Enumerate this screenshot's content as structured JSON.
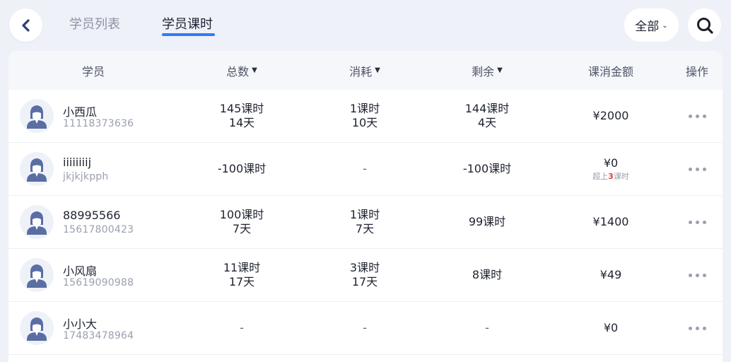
{
  "tabs": {
    "student_list": "学员列表",
    "student_hours": "学员课时"
  },
  "filter": {
    "label": "全部",
    "caret": "⌄"
  },
  "columns": {
    "student": "学员",
    "total": "总数",
    "consumed": "消耗",
    "remaining": "剩余",
    "amount": "课消金额",
    "actions": "操作"
  },
  "rows": [
    {
      "name": "小西瓜",
      "sub": "11118373636",
      "total": [
        "145课时",
        "14天"
      ],
      "consumed": [
        "1课时",
        "10天"
      ],
      "remaining": [
        "144课时",
        "4天"
      ],
      "amount": "¥2000"
    },
    {
      "name": "iiiiiiiij",
      "sub": "jkjkjkpph",
      "total": [
        "-100课时"
      ],
      "consumed": [
        "-"
      ],
      "remaining": [
        "-100课时"
      ],
      "amount": "¥0",
      "note_prefix": "超上",
      "note_count": "3",
      "note_suffix": "课时"
    },
    {
      "name": "88995566",
      "sub": "15617800423",
      "total": [
        "100课时",
        "7天"
      ],
      "consumed": [
        "1课时",
        "7天"
      ],
      "remaining": [
        "99课时"
      ],
      "amount": "¥1400"
    },
    {
      "name": "小风扇",
      "sub": "15619090988",
      "total": [
        "11课时",
        "17天"
      ],
      "consumed": [
        "3课时",
        "17天"
      ],
      "remaining": [
        "8课时"
      ],
      "amount": "¥49"
    },
    {
      "name": "小小大",
      "sub": "17483478964",
      "total": [
        "-"
      ],
      "consumed": [
        "-"
      ],
      "remaining": [
        "-"
      ],
      "amount": "¥0"
    }
  ],
  "colors": {
    "accent": "#2f7cf6",
    "background": "#eef1f8",
    "overflow_note": "#e0403a"
  }
}
